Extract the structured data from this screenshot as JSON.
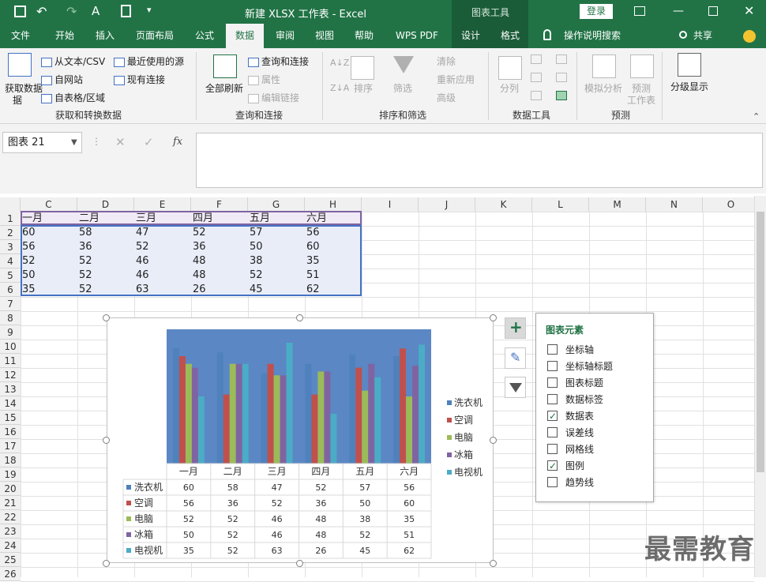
{
  "titlebar": {
    "title": "新建 XLSX 工作表 - Excel",
    "tools_label": "图表工具",
    "login": "登录"
  },
  "tabs": [
    "文件",
    "开始",
    "插入",
    "页面布局",
    "公式",
    "数据",
    "审阅",
    "视图",
    "帮助",
    "WPS PDF",
    "设计",
    "格式"
  ],
  "active_tab": "数据",
  "tell_me": "操作说明搜索",
  "share": "共享",
  "ribbon": {
    "get_data": "获取数据",
    "get_data2": "据",
    "from_csv": "从文本/CSV",
    "from_web": "自网站",
    "from_table": "自表格/区域",
    "recent_sources": "最近使用的源",
    "existing_conn": "现有连接",
    "group1": "获取和转换数据",
    "refresh_all": "全部刷新",
    "queries_conn": "查询和连接",
    "properties": "属性",
    "edit_links": "编辑链接",
    "group2": "查询和连接",
    "sort": "排序",
    "filter": "筛选",
    "clear": "清除",
    "reapply": "重新应用",
    "advanced": "高级",
    "group3": "排序和筛选",
    "split": "分列",
    "group4": "数据工具",
    "whatif": "模拟分析",
    "forecast": "预测",
    "forecast_sheet": "工作表",
    "group5": "预测",
    "outline": "分级显示"
  },
  "namebox": "图表 21",
  "fx": "fx",
  "columns": [
    "C",
    "D",
    "E",
    "F",
    "G",
    "H",
    "I",
    "J",
    "K",
    "L",
    "M",
    "N",
    "O"
  ],
  "rows": [
    "1",
    "2",
    "3",
    "4",
    "5",
    "6",
    "7",
    "8",
    "9",
    "10",
    "11",
    "12",
    "13",
    "14",
    "15",
    "16",
    "17",
    "18",
    "19",
    "20",
    "21",
    "22",
    "23",
    "24",
    "25",
    "26"
  ],
  "table": [
    [
      "一月",
      "二月",
      "三月",
      "四月",
      "五月",
      "六月"
    ],
    [
      "60",
      "58",
      "47",
      "52",
      "57",
      "56"
    ],
    [
      "56",
      "36",
      "52",
      "36",
      "50",
      "60"
    ],
    [
      "52",
      "52",
      "46",
      "48",
      "38",
      "35"
    ],
    [
      "50",
      "52",
      "46",
      "48",
      "52",
      "51"
    ],
    [
      "35",
      "52",
      "63",
      "26",
      "45",
      "62"
    ]
  ],
  "chart_data": {
    "type": "bar",
    "categories": [
      "一月",
      "二月",
      "三月",
      "四月",
      "五月",
      "六月"
    ],
    "series": [
      {
        "name": "洗衣机",
        "values": [
          60,
          58,
          47,
          52,
          57,
          56
        ],
        "color": "#4f81bd"
      },
      {
        "name": "空调",
        "values": [
          56,
          36,
          52,
          36,
          50,
          60
        ],
        "color": "#c0504d"
      },
      {
        "name": "电脑",
        "values": [
          52,
          52,
          46,
          48,
          38,
          35
        ],
        "color": "#9bbb59"
      },
      {
        "name": "冰箱",
        "values": [
          50,
          52,
          46,
          48,
          52,
          51
        ],
        "color": "#8064a2"
      },
      {
        "name": "电视机",
        "values": [
          35,
          52,
          63,
          26,
          45,
          62
        ],
        "color": "#4bacc6"
      }
    ],
    "ylim": [
      0,
      70
    ],
    "plot_background": "#5b87c5",
    "legend": "right",
    "data_table": true
  },
  "panel": {
    "title": "图表元素",
    "items": [
      {
        "label": "坐标轴",
        "checked": false
      },
      {
        "label": "坐标轴标题",
        "checked": false
      },
      {
        "label": "图表标题",
        "checked": false
      },
      {
        "label": "数据标签",
        "checked": false
      },
      {
        "label": "数据表",
        "checked": true
      },
      {
        "label": "误差线",
        "checked": false
      },
      {
        "label": "网格线",
        "checked": false
      },
      {
        "label": "图例",
        "checked": true
      },
      {
        "label": "趋势线",
        "checked": false
      }
    ]
  },
  "watermark": "最需教育",
  "colors": {
    "excel_green": "#217346",
    "accent": "#217346"
  }
}
